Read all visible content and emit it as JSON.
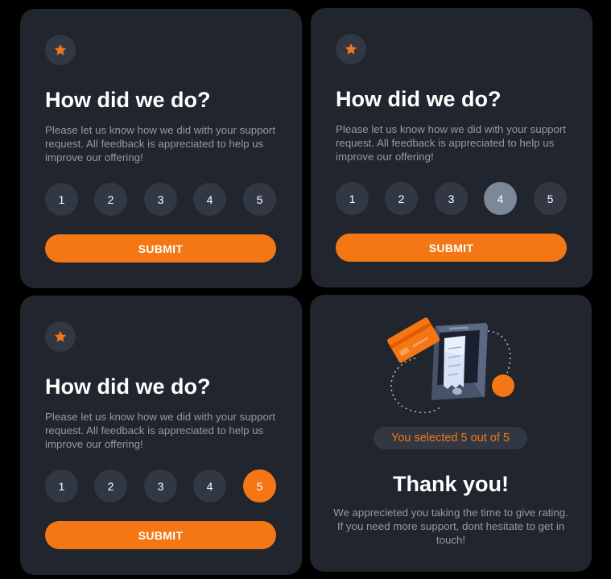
{
  "cards": [
    {
      "title": "How did we do?",
      "description": "Please let us know how we did with your support request. All feedback is appreciated to help us improve our offering!",
      "ratings": [
        "1",
        "2",
        "3",
        "4",
        "5"
      ],
      "state": "default",
      "submit_label": "SUBMIT"
    },
    {
      "title": "How did we do?",
      "description": "Please let us know how we did with your support request. All feedback is appreciated to help us improve our offering!",
      "ratings": [
        "1",
        "2",
        "3",
        "4",
        "5"
      ],
      "state": "hover",
      "hovered_rating": "4",
      "submit_label": "SUBMIT"
    },
    {
      "title": "How did we do?",
      "description": "Please let us know how we did with your support request. All feedback is appreciated to help us improve our offering!",
      "ratings": [
        "1",
        "2",
        "3",
        "4",
        "5"
      ],
      "state": "selected",
      "selected_rating": "5",
      "submit_label": "SUBMIT"
    }
  ],
  "thank_you": {
    "selected_text": "You selected 5 out of 5",
    "title": "Thank you!",
    "message": "We apprecieted you taking the time to give rating. If you need more support, dont hesitate to get in touch!"
  },
  "icons": {
    "rating_badge": "star-icon",
    "illustration": "phone-payment-illustration"
  },
  "colors": {
    "page_background": "#000000",
    "card_background": "#20252e",
    "accent": "#f57614",
    "rating_default": "#323843",
    "rating_hover": "#7c8798",
    "body_text": "#939aa6",
    "heading_text": "#ffffff"
  }
}
